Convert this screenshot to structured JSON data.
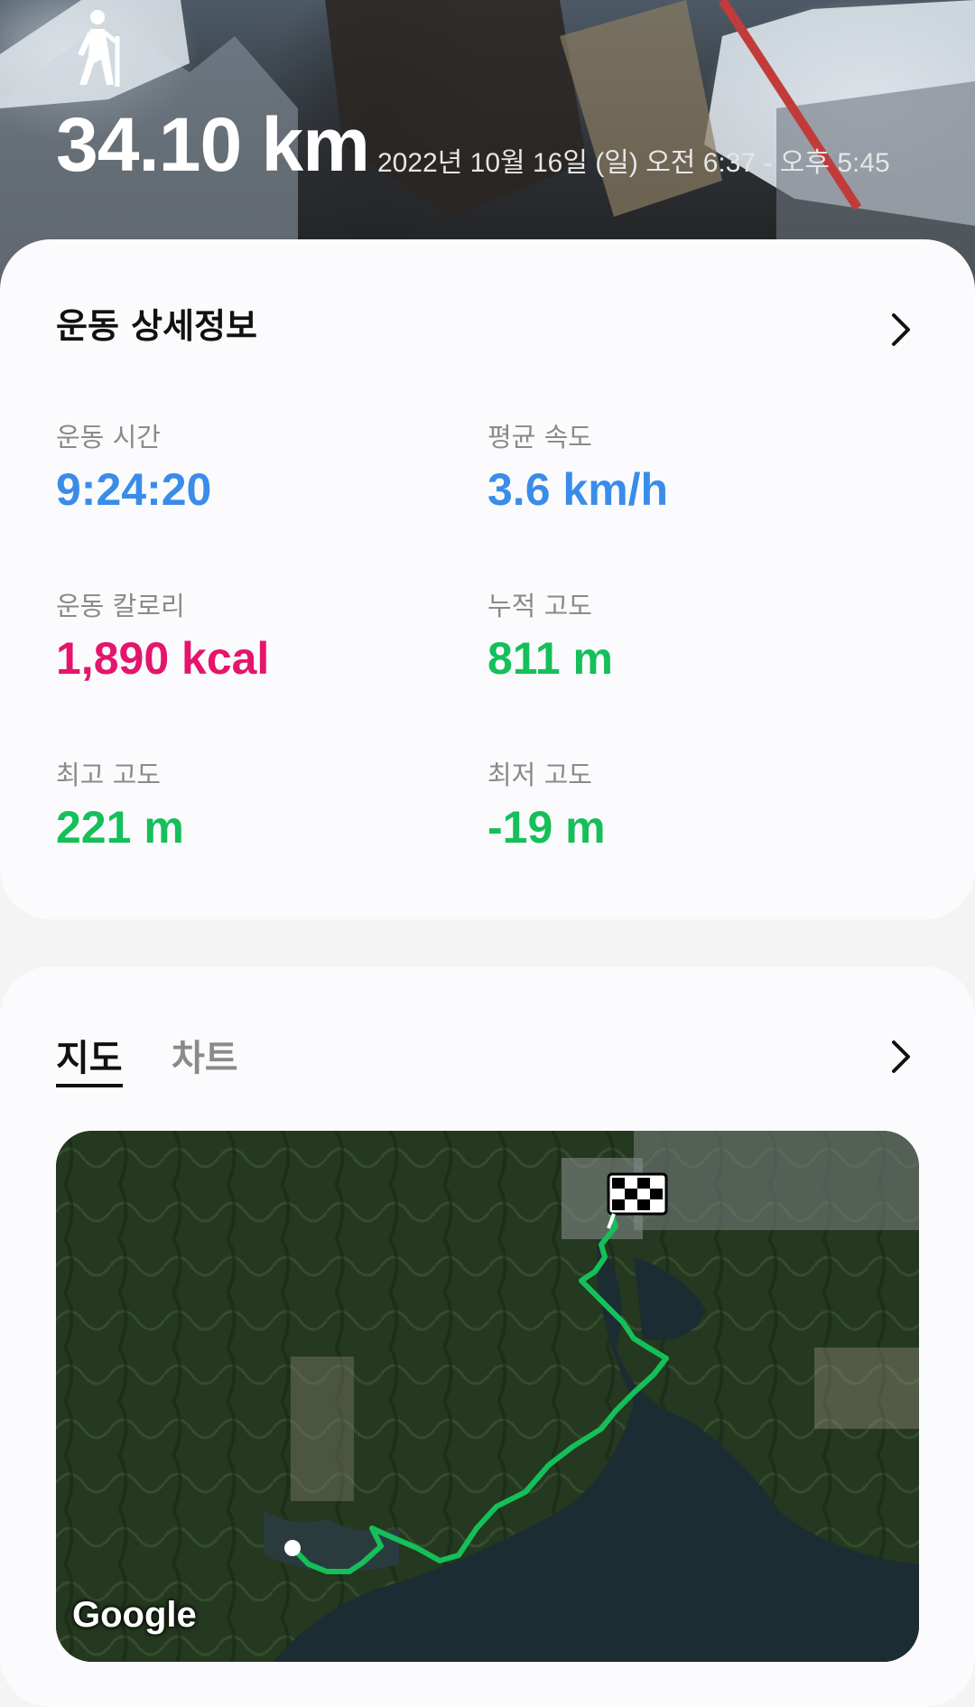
{
  "hero": {
    "activity_icon": "hiking-person-icon",
    "distance": "34.10 km",
    "date_time": "2022년 10월 16일 (일) 오전 6:37 - 오후 5:45"
  },
  "details": {
    "title": "운동 상세정보",
    "more_icon": "chevron-right-icon",
    "stats": [
      {
        "label": "운동 시간",
        "value": "9:24:20",
        "color": "#3a8ce9"
      },
      {
        "label": "평균 속도",
        "value": "3.6 km/h",
        "color": "#3a8ce9"
      },
      {
        "label": "운동 칼로리",
        "value": "1,890 kcal",
        "color": "#e4156c"
      },
      {
        "label": "누적 고도",
        "value": "811 m",
        "color": "#15bf5a"
      },
      {
        "label": "최고 고도",
        "value": "221 m",
        "color": "#15bf5a"
      },
      {
        "label": "최저 고도",
        "value": "-19 m",
        "color": "#15bf5a"
      }
    ]
  },
  "map_section": {
    "tabs": [
      {
        "label": "지도",
        "active": true
      },
      {
        "label": "차트",
        "active": false
      }
    ],
    "more_icon": "chevron-right-icon",
    "provider_logo": "Google",
    "route_color": "#15bf5a",
    "start_marker": "start-dot-icon",
    "finish_marker": "checkered-flag-icon"
  }
}
